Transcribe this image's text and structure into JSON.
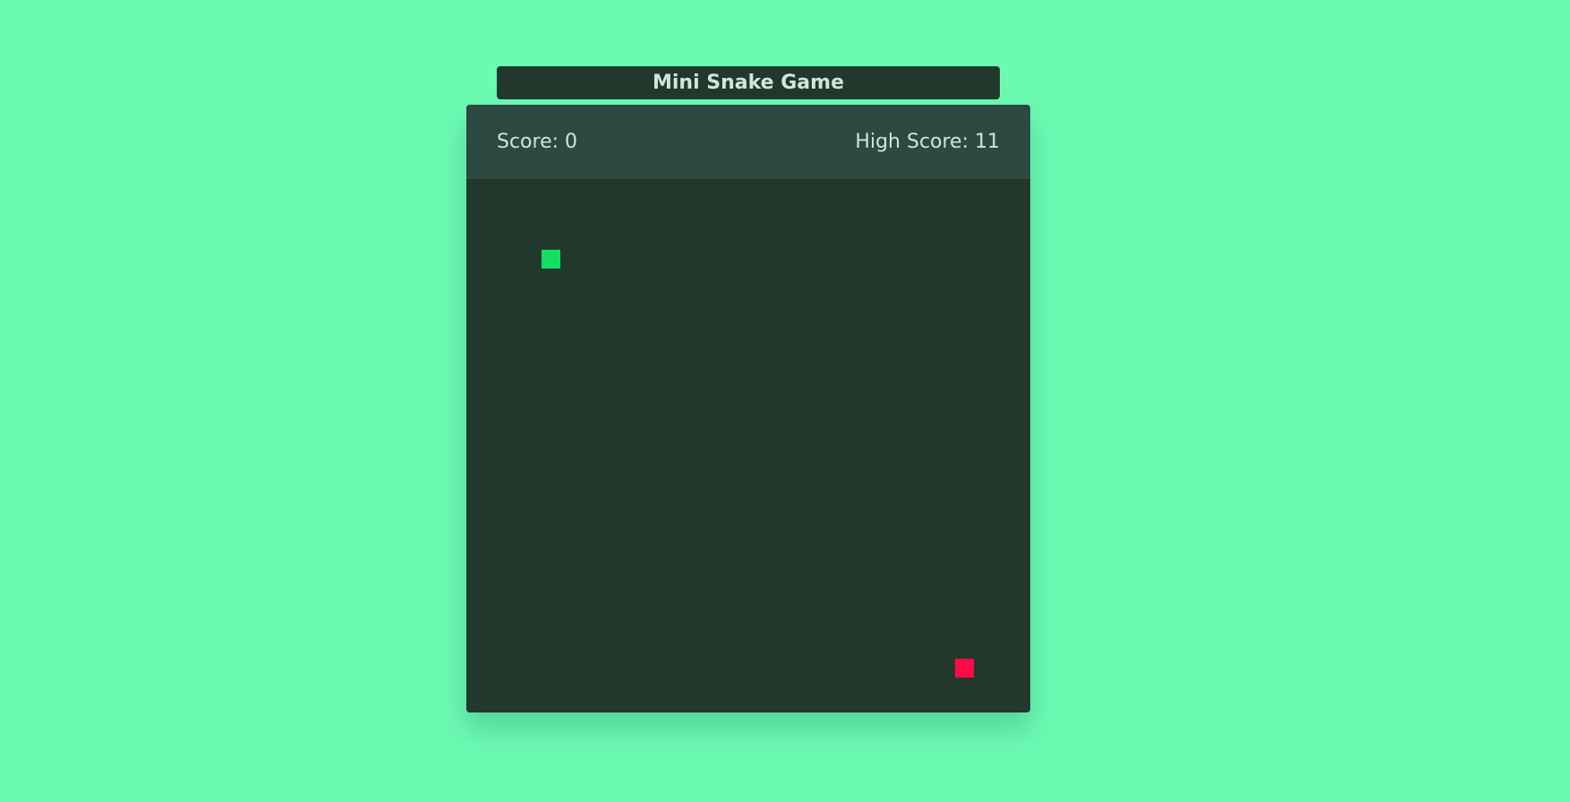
{
  "header": {
    "title": "Mini Snake Game"
  },
  "scoreboard": {
    "score_label": "Score: 0",
    "high_score_label": "High Score: 11"
  },
  "colors": {
    "background": "#6cf9b2",
    "panel": "#22382d",
    "score_bar": "#2c4942",
    "snake": "#12e063",
    "food": "#ff0a45"
  }
}
